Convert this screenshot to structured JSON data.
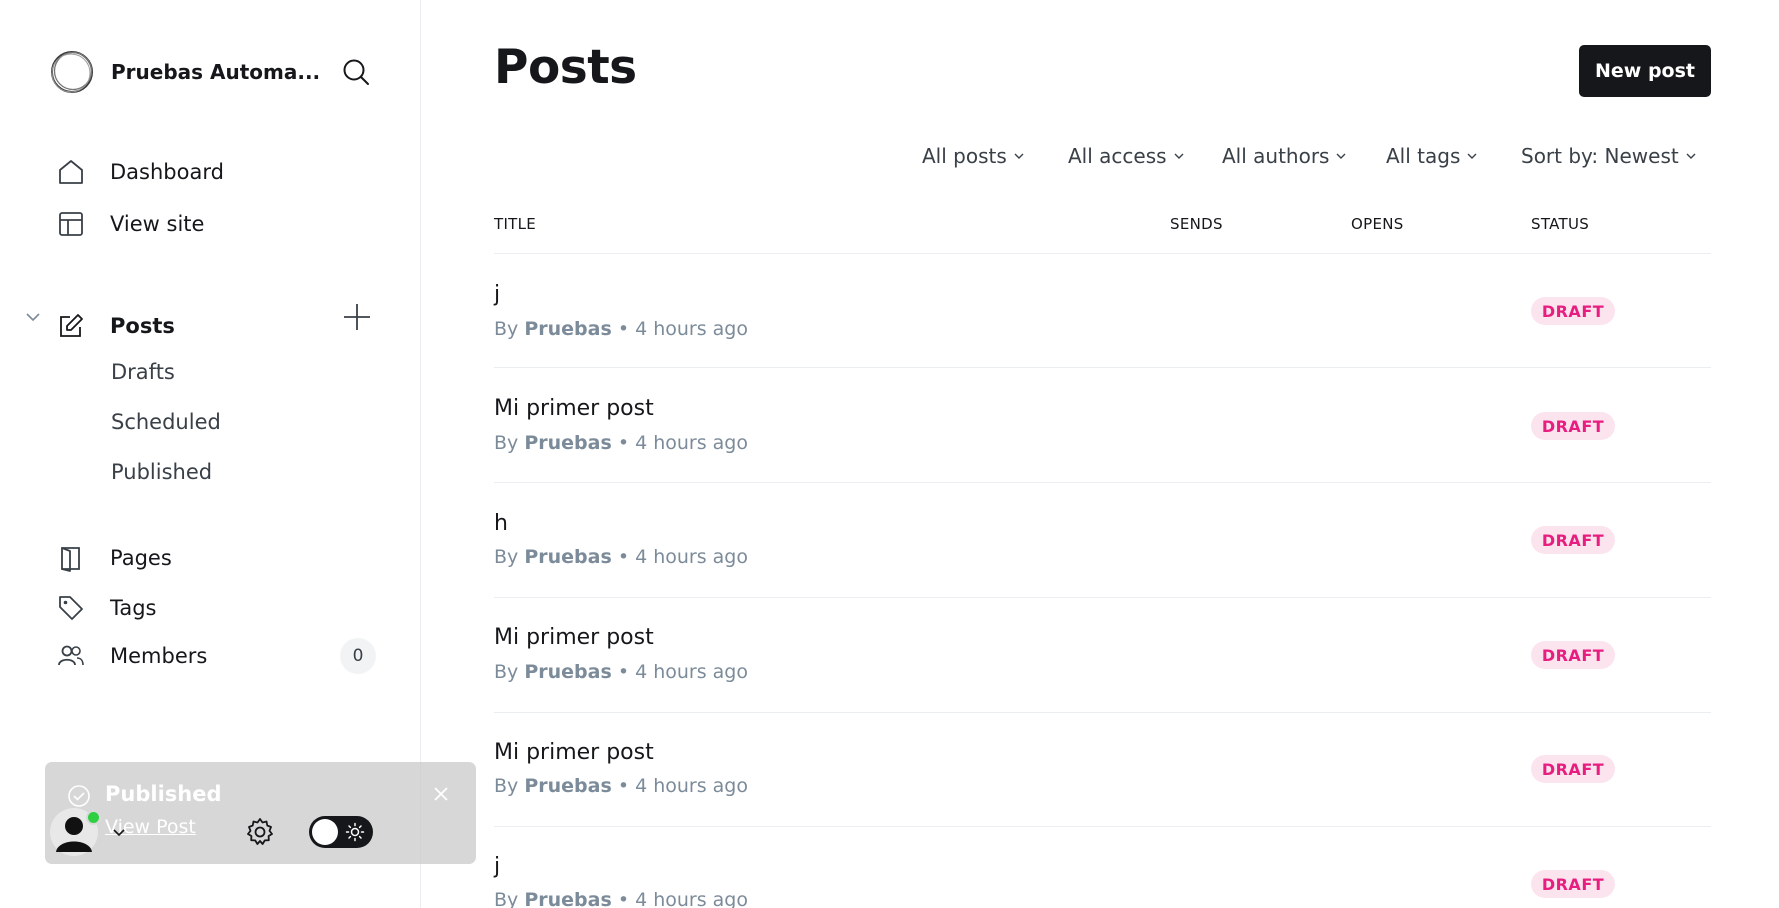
{
  "sidebar": {
    "site_name": "Pruebas Automa...",
    "nav": {
      "dashboard": "Dashboard",
      "view_site": "View site",
      "posts": "Posts",
      "drafts": "Drafts",
      "scheduled": "Scheduled",
      "published": "Published",
      "pages": "Pages",
      "tags": "Tags",
      "members": "Members",
      "members_count": "0"
    }
  },
  "toast": {
    "title": "Published",
    "link": "View Post"
  },
  "main": {
    "title": "Posts",
    "new_post": "New post",
    "filters": {
      "type": "All posts",
      "access": "All access",
      "authors": "All authors",
      "tags": "All tags",
      "sort": "Sort by: Newest"
    },
    "columns": {
      "title": "TITLE",
      "sends": "SENDS",
      "opens": "OPENS",
      "status": "STATUS"
    },
    "posts": [
      {
        "title": "j",
        "author": "Pruebas",
        "time": "• 4 hours ago",
        "by": "By",
        "status": "DRAFT"
      },
      {
        "title": "Mi primer post",
        "author": "Pruebas",
        "time": "• 4 hours ago",
        "by": "By",
        "status": "DRAFT"
      },
      {
        "title": "h",
        "author": "Pruebas",
        "time": "• 4 hours ago",
        "by": "By",
        "status": "DRAFT"
      },
      {
        "title": "Mi primer post",
        "author": "Pruebas",
        "time": "• 4 hours ago",
        "by": "By",
        "status": "DRAFT"
      },
      {
        "title": "Mi primer post",
        "author": "Pruebas",
        "time": "• 4 hours ago",
        "by": "By",
        "status": "DRAFT"
      },
      {
        "title": "j",
        "author": "Pruebas",
        "time": "• 4 hours ago",
        "by": "By",
        "status": "DRAFT"
      }
    ]
  },
  "colors": {
    "accent": "#15171a",
    "draft_badge_bg": "#fce4ef",
    "draft_badge_text": "#e71e7f",
    "online": "#30cf43"
  }
}
